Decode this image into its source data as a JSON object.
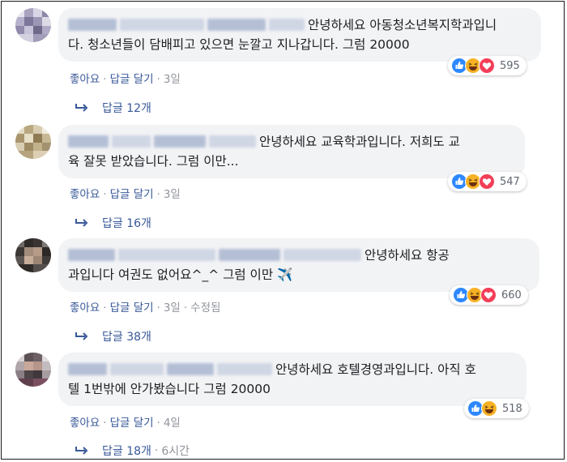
{
  "colors": {
    "link": "#385898",
    "muted": "#90949c",
    "bubble": "#f2f3f5",
    "like": "#2d88ff",
    "love": "#f33e58",
    "haha": "#f7b125"
  },
  "comments": [
    {
      "text_line1": "안녕하세요 아동청소년복지학과입니",
      "text_line2": "다. 청소년들이 담배피고 있으면 눈깔고 지나갑니다. 그럼 20000",
      "like_label": "좋아요",
      "reply_label": "답글 달기",
      "time": "3일",
      "edited": "",
      "reaction_icons": [
        "like-icon",
        "haha-icon",
        "love-icon"
      ],
      "reaction_count": "595",
      "replies_label": "답글 12개",
      "replies_time": ""
    },
    {
      "text_line1": "안녕하세요 교육학과입니다. 저희도 교",
      "text_line2": "육 잘못 받았습니다. 그럼 이만...",
      "like_label": "좋아요",
      "reply_label": "답글 달기",
      "time": "3일",
      "edited": "",
      "reaction_icons": [
        "like-icon",
        "haha-icon",
        "love-icon"
      ],
      "reaction_count": "547",
      "replies_label": "답글 16개",
      "replies_time": ""
    },
    {
      "text_line1": "안녕하세요 항공",
      "text_line2": "과입니다 여권도 없어요^_^ 그럼 이만 ✈️",
      "like_label": "좋아요",
      "reply_label": "답글 달기",
      "time": "3일",
      "edited": "수정됨",
      "reaction_icons": [
        "like-icon",
        "haha-icon",
        "love-icon"
      ],
      "reaction_count": "660",
      "replies_label": "답글 38개",
      "replies_time": ""
    },
    {
      "text_line1": "안녕하세요 호텔경영과입니다. 아직 호",
      "text_line2": "텔 1번밖에 안가봤습니다 그럼 20000",
      "like_label": "좋아요",
      "reply_label": "답글 달기",
      "time": "4일",
      "edited": "",
      "reaction_icons": [
        "like-icon",
        "haha-icon"
      ],
      "reaction_count": "518",
      "replies_label": "답글 18개",
      "replies_time": "6시간"
    }
  ]
}
